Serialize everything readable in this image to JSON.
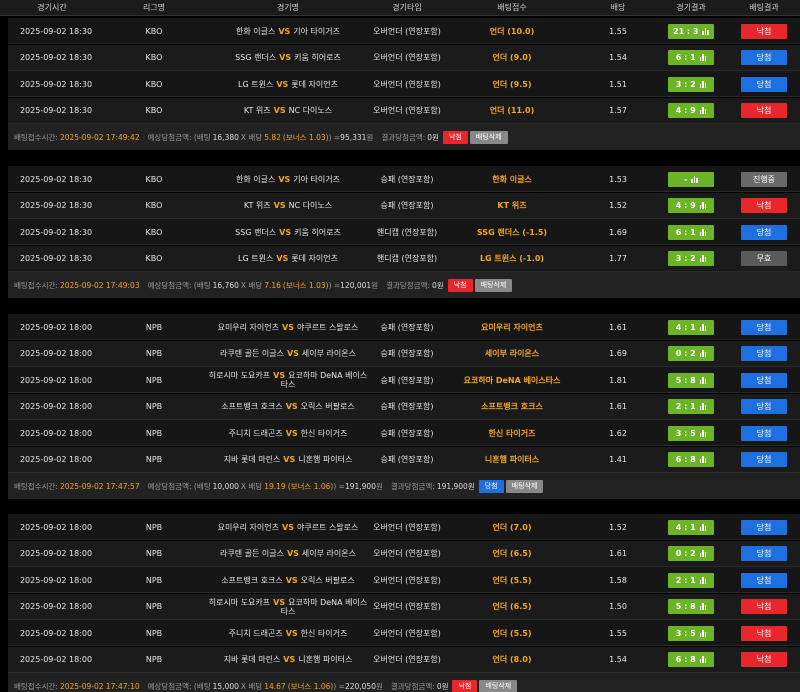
{
  "header": {
    "time": "경기시간",
    "league": "리그명",
    "match": "경기명",
    "type": "경기타입",
    "pick": "배팅접수",
    "odds": "배당",
    "result": "경기결과",
    "status": "배팅결과"
  },
  "vs_label": "VS",
  "blocks": [
    {
      "rows": [
        {
          "time": "2025-09-02 18:30",
          "league": "KBO",
          "home": "한화 이글스",
          "away": "기아 타이거즈",
          "type": "오버언더 (연장포함)",
          "pick": "언더 (10.0)",
          "odds": "1.55",
          "score": "21 : 3",
          "status": "낙첨",
          "status_kind": "lose"
        },
        {
          "time": "2025-09-02 18:30",
          "league": "KBO",
          "home": "SSG 랜더스",
          "away": "키움 히어로즈",
          "type": "오버언더 (연장포함)",
          "pick": "언더 (9.0)",
          "odds": "1.54",
          "score": "6 : 1",
          "status": "당첨",
          "status_kind": "win"
        },
        {
          "time": "2025-09-02 18:30",
          "league": "KBO",
          "home": "LG 트윈스",
          "away": "롯데 자이언츠",
          "type": "오버언더 (연장포함)",
          "pick": "언더 (9.5)",
          "odds": "1.51",
          "score": "3 : 2",
          "status": "당첨",
          "status_kind": "win"
        },
        {
          "time": "2025-09-02 18:30",
          "league": "KBO",
          "home": "KT 위즈",
          "away": "NC 다이노스",
          "type": "오버언더 (연장포함)",
          "pick": "언더 (11.0)",
          "odds": "1.57",
          "score": "4 : 9",
          "status": "낙첨",
          "status_kind": "lose"
        }
      ],
      "summary": {
        "label": "배팅접수시간:",
        "time": "2025-09-02 17:49:42",
        "exp_label": "예상당첨금액: (배팅",
        "bet": "16,380",
        "x": "X 배당",
        "odds": "5.82",
        "bonus": "(보너스 1.03)",
        "eq": ") = ",
        "amount": "95,331",
        "won": "원",
        "res_label": "결과당첨금액:",
        "res_amount": "0원",
        "status": "낙첨",
        "status_kind": "lose",
        "delete": "배팅삭제"
      }
    },
    {
      "rows": [
        {
          "time": "2025-09-02 18:30",
          "league": "KBO",
          "home": "한화 이글스",
          "away": "기아 타이거즈",
          "type": "승패 (연장포함)",
          "pick": "한화 이글스",
          "odds": "1.53",
          "score": "-",
          "status": "진행중",
          "status_kind": "prog"
        },
        {
          "time": "2025-09-02 18:30",
          "league": "KBO",
          "home": "KT 위즈",
          "away": "NC 다이노스",
          "type": "승패 (연장포함)",
          "pick": "KT 위즈",
          "odds": "1.52",
          "score": "4 : 9",
          "status": "낙첨",
          "status_kind": "lose"
        },
        {
          "time": "2025-09-02 18:30",
          "league": "KBO",
          "home": "SSG 랜더스",
          "away": "키움 히어로즈",
          "type": "핸디캡 (연장포함)",
          "pick": "SSG 랜더스 (-1.5)",
          "odds": "1.69",
          "score": "6 : 1",
          "status": "당첨",
          "status_kind": "win"
        },
        {
          "time": "2025-09-02 18:30",
          "league": "KBO",
          "home": "LG 트윈스",
          "away": "롯데 자이언츠",
          "type": "핸디캡 (연장포함)",
          "pick": "LG 트윈스 (-1.0)",
          "odds": "1.77",
          "score": "3 : 2",
          "status": "무효",
          "status_kind": "void"
        }
      ],
      "summary": {
        "label": "배팅접수시간:",
        "time": "2025-09-02 17:49:03",
        "exp_label": "예상당첨금액: (배팅",
        "bet": "16,760",
        "x": "X 배당",
        "odds": "7.16",
        "bonus": "(보너스 1.03)",
        "eq": ") = ",
        "amount": "120,001",
        "won": "원",
        "res_label": "결과당첨금액:",
        "res_amount": "0원",
        "status": "낙첨",
        "status_kind": "lose",
        "delete": "배팅삭제"
      }
    },
    {
      "rows": [
        {
          "time": "2025-09-02 18:00",
          "league": "NPB",
          "home": "요미우리 자이언츠",
          "away": "야쿠르트 스왈로스",
          "type": "승패 (연장포함)",
          "pick": "요미우리 자이언츠",
          "odds": "1.61",
          "score": "4 : 1",
          "status": "당첨",
          "status_kind": "win"
        },
        {
          "time": "2025-09-02 18:00",
          "league": "NPB",
          "home": "라쿠텐 골든 이글스",
          "away": "세이부 라이온스",
          "type": "승패 (연장포함)",
          "pick": "세이부 라이온스",
          "odds": "1.69",
          "score": "0 : 2",
          "status": "당첨",
          "status_kind": "win"
        },
        {
          "time": "2025-09-02 18:00",
          "league": "NPB",
          "home": "히로시마 도요카프",
          "away": "요코하마 DeNA 베이스타스",
          "type": "승패 (연장포함)",
          "pick": "요코하마 DeNA 베이스타스",
          "odds": "1.81",
          "score": "5 : 8",
          "status": "당첨",
          "status_kind": "win"
        },
        {
          "time": "2025-09-02 18:00",
          "league": "NPB",
          "home": "소프트뱅크 호크스",
          "away": "오릭스 버팔로스",
          "type": "승패 (연장포함)",
          "pick": "소프트뱅크 호크스",
          "odds": "1.61",
          "score": "2 : 1",
          "status": "당첨",
          "status_kind": "win"
        },
        {
          "time": "2025-09-02 18:00",
          "league": "NPB",
          "home": "주니치 드래곤즈",
          "away": "한신 타이거즈",
          "type": "승패 (연장포함)",
          "pick": "한신 타이거즈",
          "odds": "1.62",
          "score": "3 : 5",
          "status": "당첨",
          "status_kind": "win"
        },
        {
          "time": "2025-09-02 18:00",
          "league": "NPB",
          "home": "지바 롯데 마린스",
          "away": "니혼햄 파이터스",
          "type": "승패 (연장포함)",
          "pick": "니혼햄 파이터스",
          "odds": "1.41",
          "score": "6 : 8",
          "status": "당첨",
          "status_kind": "win"
        }
      ],
      "summary": {
        "label": "배팅접수시간:",
        "time": "2025-09-02 17:47:57",
        "exp_label": "예상당첨금액: (배팅",
        "bet": "10,000",
        "x": "X 배당",
        "odds": "19.19",
        "bonus": "(보너스 1.06)",
        "eq": ") = ",
        "amount": "191,900",
        "won": "원",
        "res_label": "결과당첨금액:",
        "res_amount": "191,900원",
        "status": "당첨",
        "status_kind": "win",
        "delete": "배팅삭제"
      }
    },
    {
      "rows": [
        {
          "time": "2025-09-02 18:00",
          "league": "NPB",
          "home": "요미우리 자이언츠",
          "away": "야쿠르트 스왈로스",
          "type": "오버언더 (연장포함)",
          "pick": "언더 (7.0)",
          "odds": "1.52",
          "score": "4 : 1",
          "status": "당첨",
          "status_kind": "win"
        },
        {
          "time": "2025-09-02 18:00",
          "league": "NPB",
          "home": "라쿠텐 골든 이글스",
          "away": "세이부 라이온스",
          "type": "오버언더 (연장포함)",
          "pick": "언더 (6.5)",
          "odds": "1.61",
          "score": "0 : 2",
          "status": "당첨",
          "status_kind": "win"
        },
        {
          "time": "2025-09-02 18:00",
          "league": "NPB",
          "home": "소프트뱅크 호크스",
          "away": "오릭스 버팔로스",
          "type": "오버언더 (연장포함)",
          "pick": "언더 (5.5)",
          "odds": "1.58",
          "score": "2 : 1",
          "status": "당첨",
          "status_kind": "win"
        },
        {
          "time": "2025-09-02 18:00",
          "league": "NPB",
          "home": "히로시마 도요카프",
          "away": "요코하마 DeNA 베이스타스",
          "type": "오버언더 (연장포함)",
          "pick": "언더 (6.5)",
          "odds": "1.50",
          "score": "5 : 8",
          "status": "낙첨",
          "status_kind": "lose"
        },
        {
          "time": "2025-09-02 18:00",
          "league": "NPB",
          "home": "주니치 드래곤즈",
          "away": "한신 타이거즈",
          "type": "오버언더 (연장포함)",
          "pick": "언더 (5.5)",
          "odds": "1.55",
          "score": "3 : 5",
          "status": "낙첨",
          "status_kind": "lose"
        },
        {
          "time": "2025-09-02 18:00",
          "league": "NPB",
          "home": "지바 롯데 마린스",
          "away": "니혼햄 파이터스",
          "type": "오버언더 (연장포함)",
          "pick": "언더 (8.0)",
          "odds": "1.54",
          "score": "6 : 8",
          "status": "낙첨",
          "status_kind": "lose"
        }
      ],
      "summary": {
        "label": "배팅접수시간:",
        "time": "2025-09-02 17:47:10",
        "exp_label": "예상당첨금액: (배팅",
        "bet": "15,000",
        "x": "X 배당",
        "odds": "14.67",
        "bonus": "(보너스 1.06)",
        "eq": ") = ",
        "amount": "220,050",
        "won": "원",
        "res_label": "결과당첨금액:",
        "res_amount": "0원",
        "status": "낙첨",
        "status_kind": "lose",
        "delete": "배팅삭제"
      }
    }
  ]
}
